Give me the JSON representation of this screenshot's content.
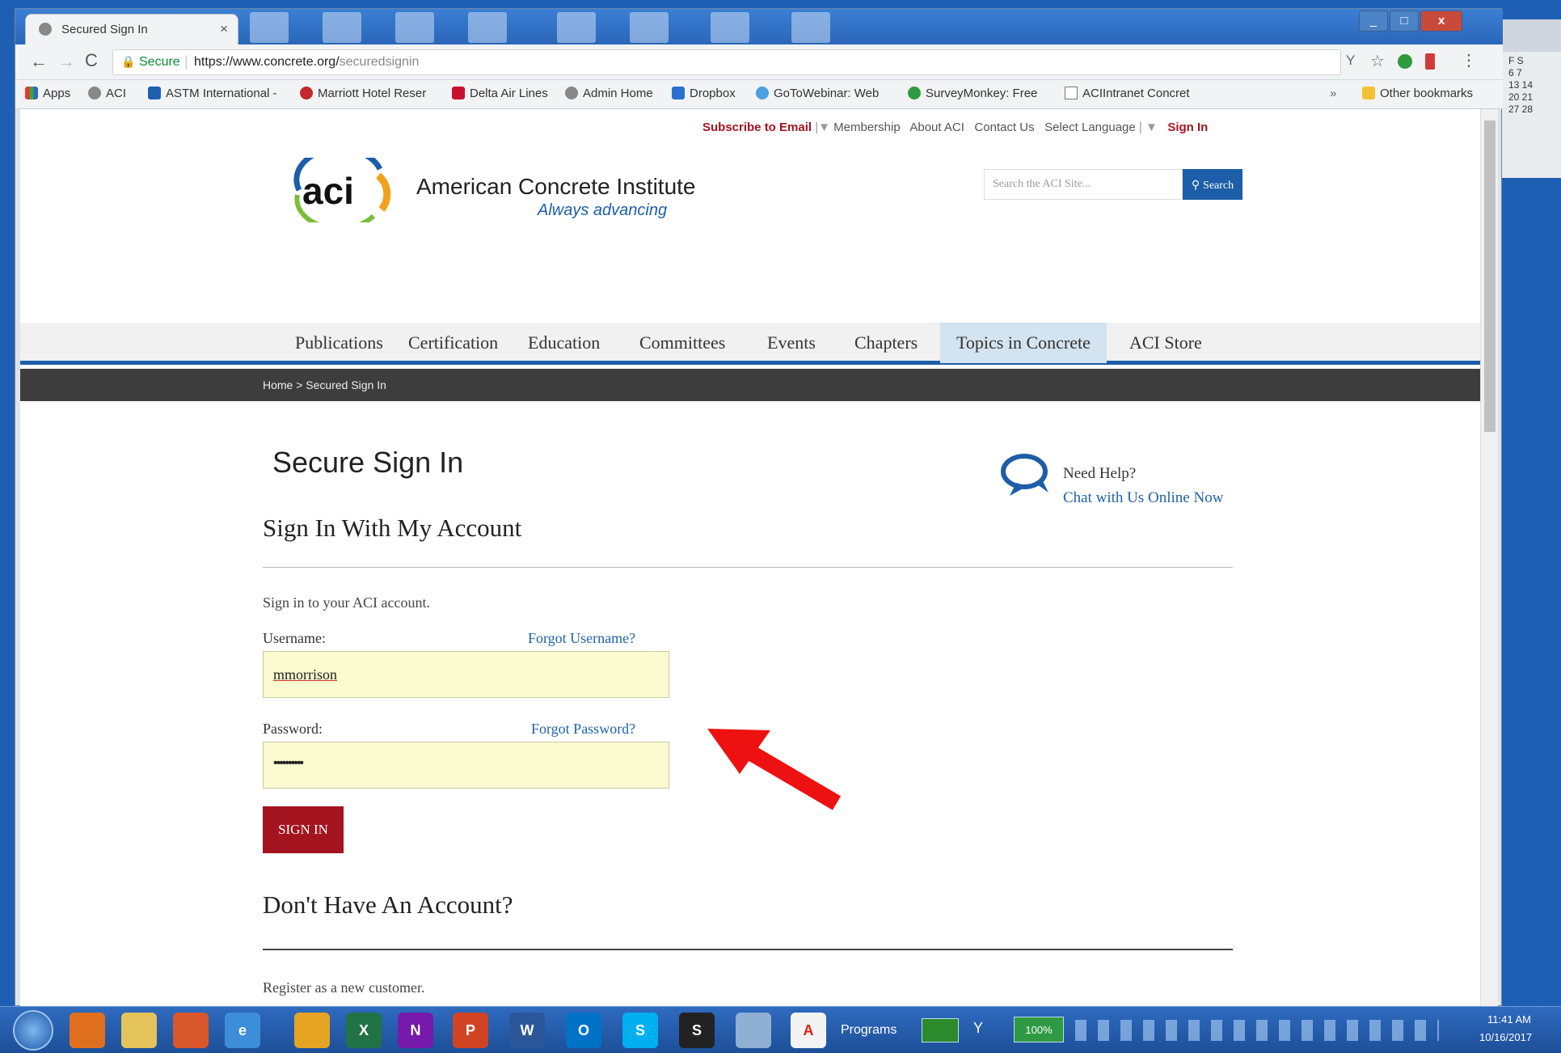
{
  "browser": {
    "tab_title": "Secured Sign In",
    "tab_close": "×",
    "url_secure": "Secure",
    "url_host": "https://www.concrete.org/",
    "url_path": "securedsignin",
    "minimize": "_",
    "maximize": "□",
    "close": "x"
  },
  "bookmarks": {
    "items": [
      "Apps",
      "ACI",
      "ASTM International -",
      "Marriott Hotel Reser",
      "Delta Air Lines",
      "Admin Home",
      "Dropbox",
      "GoToWebinar: Web",
      "SurveyMonkey: Free",
      "ACIIntranet Concret"
    ],
    "other": "Other bookmarks",
    "overflow": "»"
  },
  "site": {
    "topbar": {
      "subscribe": "Subscribe to Email",
      "membership": "Membership",
      "about": "About ACI",
      "contact": "Contact Us",
      "language": "Select Language",
      "signin": "Sign In"
    },
    "logo_text": "aci",
    "org_name": "American Concrete Institute",
    "tagline": "Always advancing",
    "search_placeholder": "Search the ACI Site...",
    "search_button": "Search",
    "nav": [
      "Publications",
      "Certification",
      "Education",
      "Committees",
      "Events",
      "Chapters",
      "Topics in Concrete",
      "ACI Store"
    ],
    "breadcrumb": "Home > Secured Sign In"
  },
  "signin": {
    "title": "Secure Sign In",
    "help_title": "Need Help?",
    "help_link": "Chat with Us Online Now",
    "section_title": "Sign In With My Account",
    "intro": "Sign in to your ACI account.",
    "username_label": "Username:",
    "forgot_username": "Forgot Username?",
    "username_value": "mmorrison",
    "password_label": "Password:",
    "forgot_password": "Forgot Password?",
    "password_value": "••••••••••",
    "submit": "SIGN IN",
    "no_account_title": "Don't Have An Account?",
    "register_text": "Register as a new customer."
  },
  "taskbar": {
    "programs": "Programs",
    "battery": "100%",
    "time": "11:41 AM",
    "date": "10/16/2017"
  },
  "calendar_gadget": {
    "rows": [
      "F S",
      "6 7",
      "13 14",
      "20 21",
      "27 28"
    ]
  },
  "colors": {
    "accent_red": "#a3141f",
    "link_blue": "#1e63a8",
    "search_blue": "#1c5ea8",
    "breadcrumb_bar": "#3d3d3d",
    "nav_active": "#d3e3ef",
    "annotation_arrow": "#ee1111"
  }
}
